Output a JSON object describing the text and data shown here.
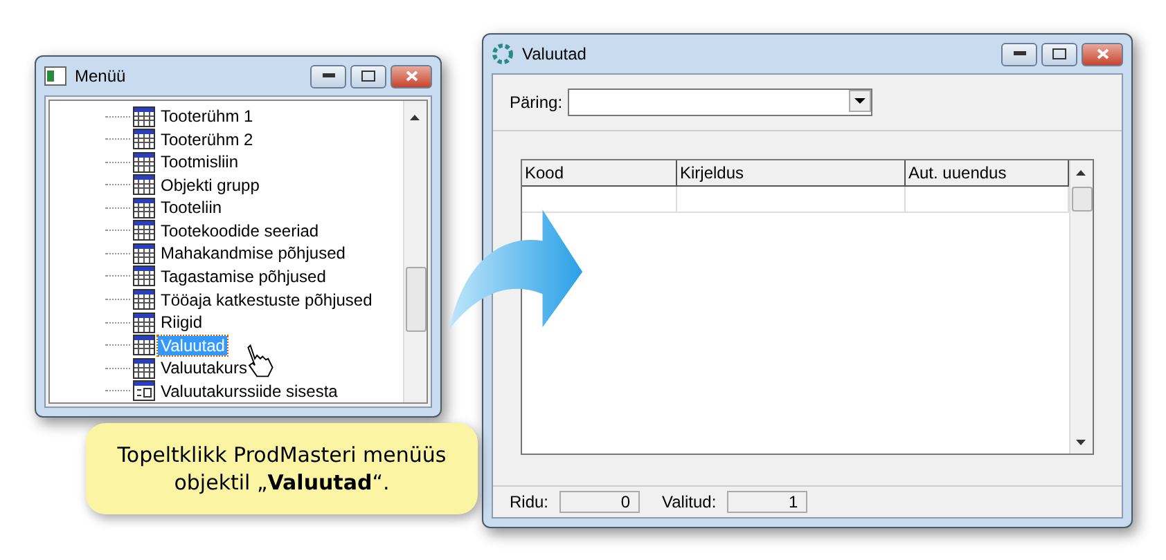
{
  "menu_window": {
    "title": "Menüü",
    "items": [
      {
        "label": "Tooterühm 1",
        "kind": "table",
        "selected": false
      },
      {
        "label": "Tooterühm 2",
        "kind": "table",
        "selected": false
      },
      {
        "label": "Tootmisliin",
        "kind": "table",
        "selected": false
      },
      {
        "label": "Objekti grupp",
        "kind": "table",
        "selected": false
      },
      {
        "label": "Tooteliin",
        "kind": "table",
        "selected": false
      },
      {
        "label": "Tootekoodide seeriad",
        "kind": "table",
        "selected": false
      },
      {
        "label": "Mahakandmise põhjused",
        "kind": "table",
        "selected": false
      },
      {
        "label": "Tagastamise põhjused",
        "kind": "table",
        "selected": false
      },
      {
        "label": "Tööaja katkestuste põhjused",
        "kind": "table",
        "selected": false
      },
      {
        "label": "Riigid",
        "kind": "table",
        "selected": false
      },
      {
        "label": "Valuutad",
        "kind": "table",
        "selected": true
      },
      {
        "label": "Valuutakurs",
        "kind": "table",
        "selected": false
      },
      {
        "label": "Valuutakurssiide sisesta",
        "kind": "form",
        "selected": false
      }
    ]
  },
  "currency_window": {
    "title": "Valuutad",
    "query": {
      "label": "Päring:"
    },
    "table": {
      "columns": [
        "Kood",
        "Kirjeldus",
        "Aut. uuendus"
      ]
    },
    "status_bar": [
      {
        "label": "Ridu:",
        "value": "0"
      },
      {
        "label": "Valitud:",
        "value": "1"
      }
    ]
  },
  "callout": {
    "text": "Topeltklikk ProdMasteri menüüs objektil „**Valuutad**“."
  }
}
